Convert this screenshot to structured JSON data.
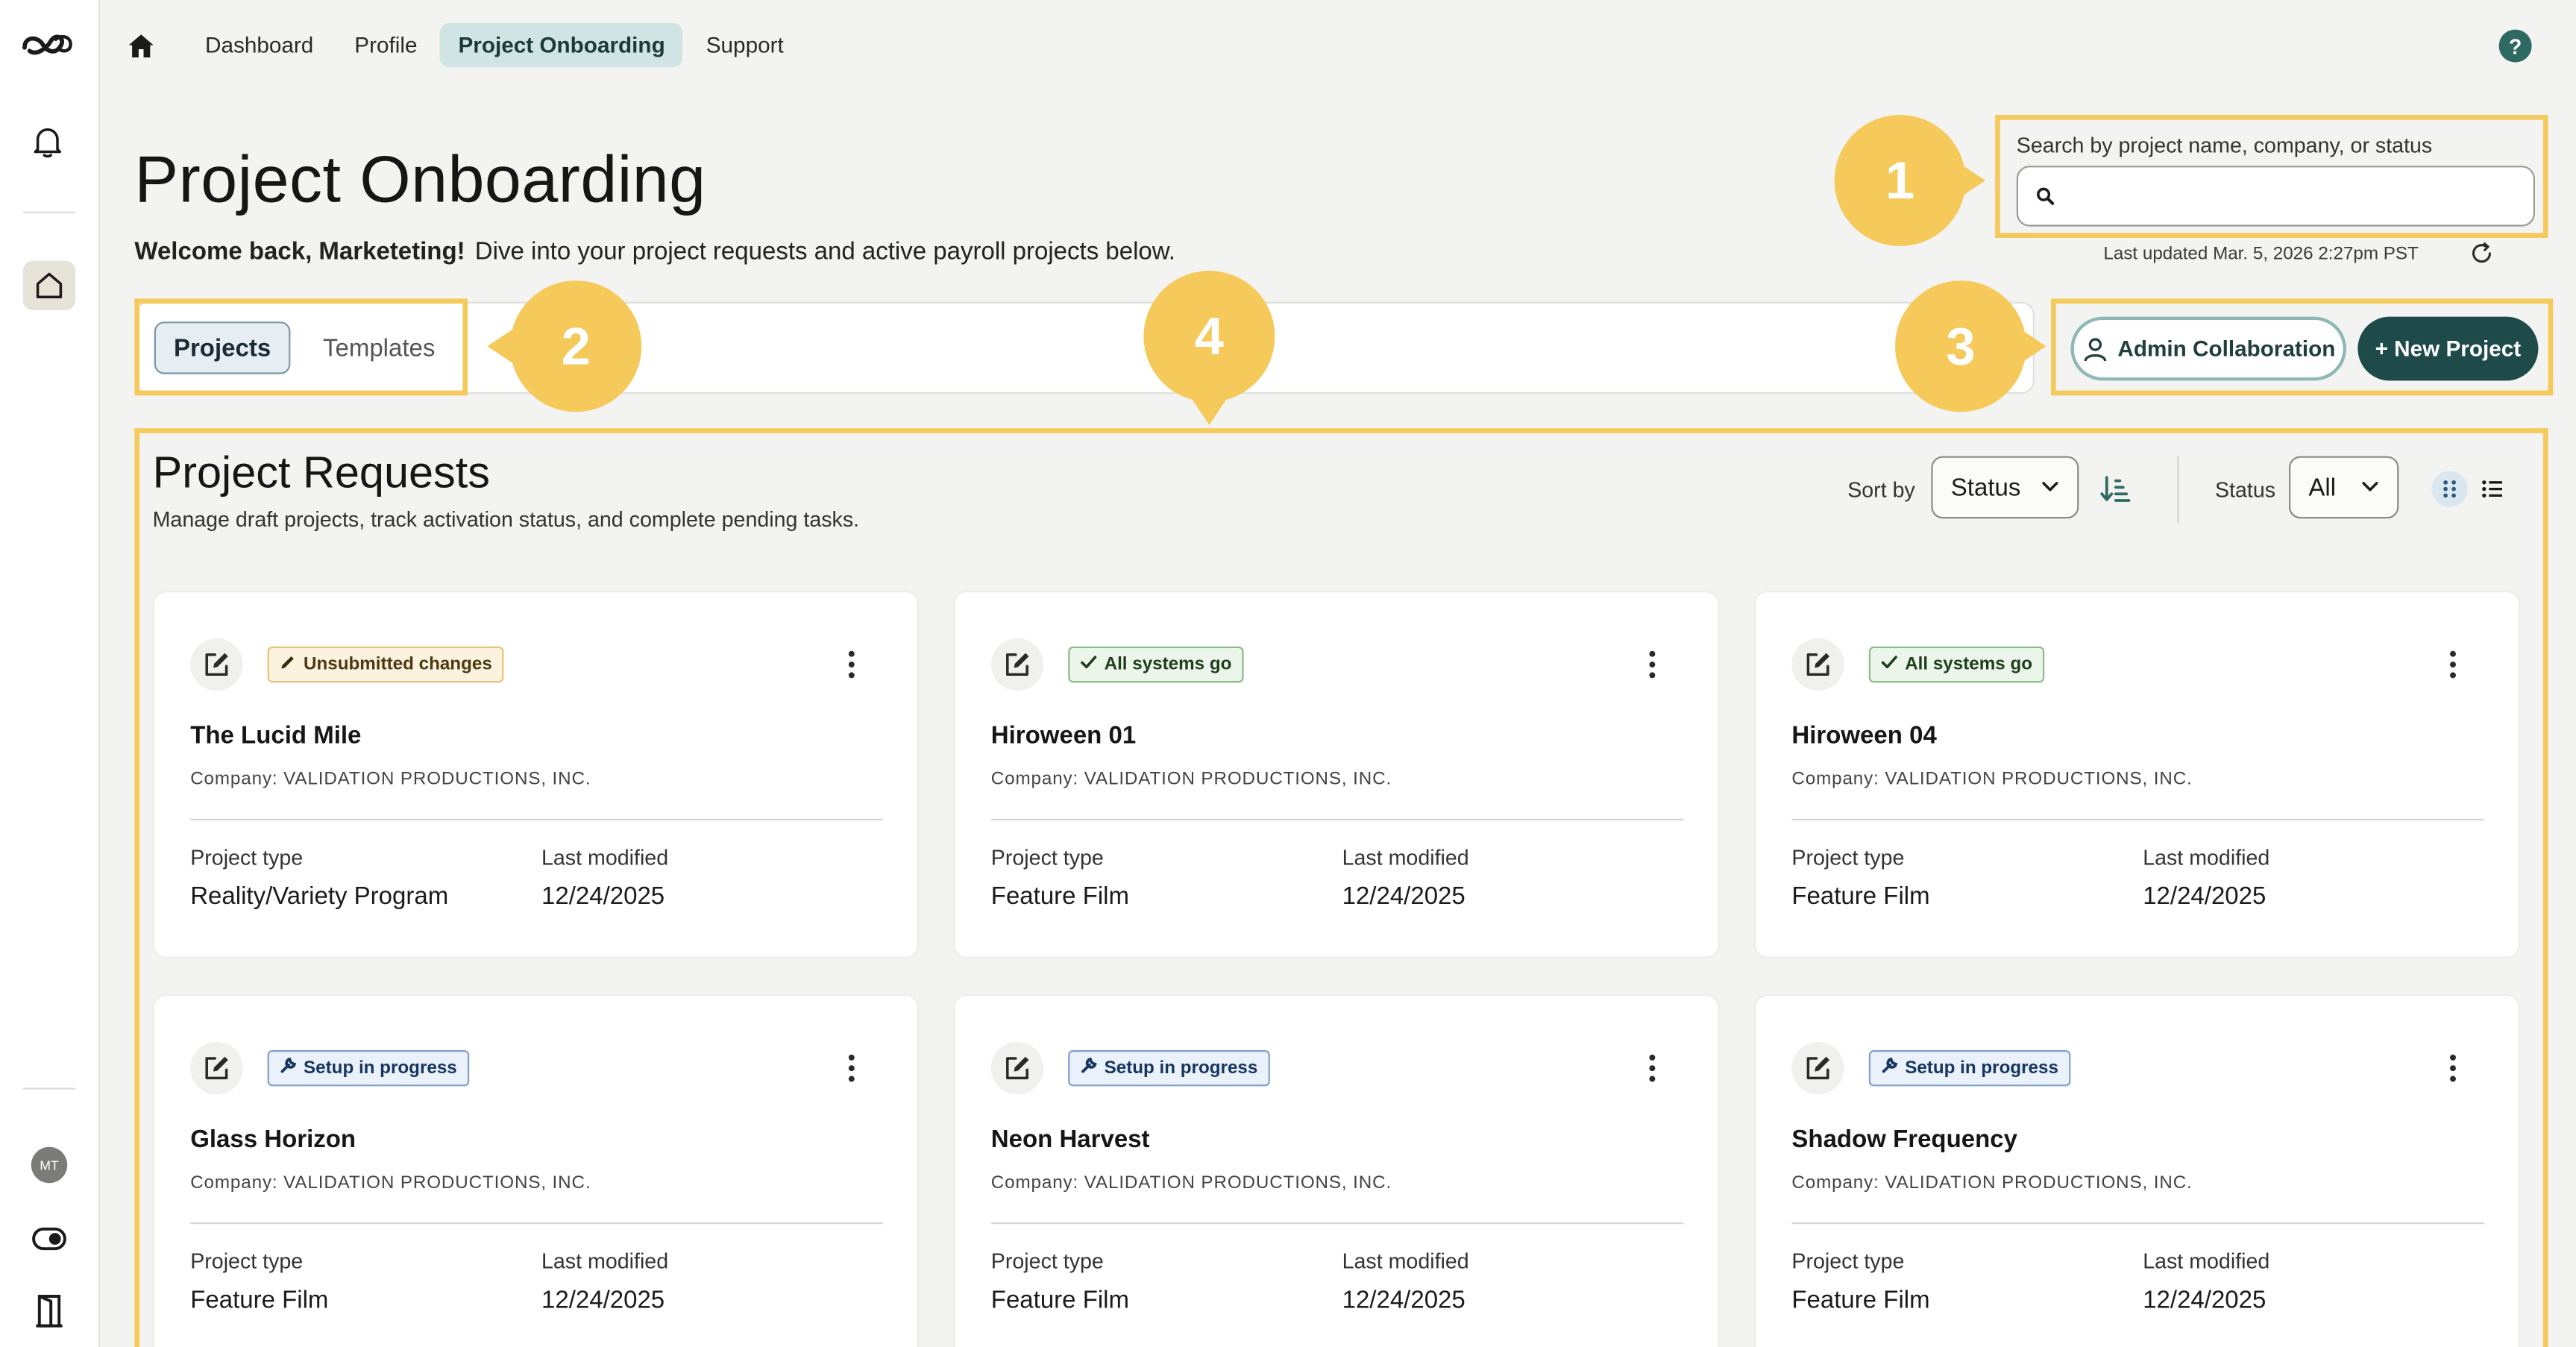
{
  "nav": {
    "links": [
      "Dashboard",
      "Profile",
      "Project Onboarding",
      "Support"
    ],
    "active_index": 2,
    "help": "?"
  },
  "user": {
    "initials": "MT"
  },
  "page": {
    "title": "Project Onboarding",
    "welcome_bold": "Welcome back, Marketeting!",
    "welcome_rest": "Dive into your project requests and active payroll projects below."
  },
  "search": {
    "label": "Search by project name, company, or status",
    "value": "",
    "placeholder": "",
    "last_updated": "Last updated Mar. 5, 2026 2:27pm PST"
  },
  "tabs": {
    "projects": "Projects",
    "templates": "Templates"
  },
  "actions": {
    "admin": "Admin Collaboration",
    "new": "+ New Project"
  },
  "callouts": [
    "1",
    "2",
    "3",
    "4"
  ],
  "requests": {
    "title": "Project Requests",
    "subtitle": "Manage draft projects, track activation status, and complete pending tasks.",
    "sort_label": "Sort by",
    "sort_value": "Status",
    "status_label": "Status",
    "status_value": "All",
    "field_type": "Project type",
    "field_modified": "Last modified",
    "cards": [
      {
        "badge": "Unsubmitted changes",
        "badge_kind": "warn",
        "name": "The Lucid Mile",
        "company": "Company: VALIDATION PRODUCTIONS, INC.",
        "type": "Reality/Variety Program",
        "modified": "12/24/2025"
      },
      {
        "badge": "All systems go",
        "badge_kind": "ok",
        "name": "Hiroween 01",
        "company": "Company: VALIDATION PRODUCTIONS, INC.",
        "type": "Feature Film",
        "modified": "12/24/2025"
      },
      {
        "badge": "All systems go",
        "badge_kind": "ok",
        "name": "Hiroween 04",
        "company": "Company: VALIDATION PRODUCTIONS, INC.",
        "type": "Feature Film",
        "modified": "12/24/2025"
      },
      {
        "badge": "Setup in progress",
        "badge_kind": "setup",
        "name": "Glass Horizon",
        "company": "Company: VALIDATION PRODUCTIONS, INC.",
        "type": "Feature Film",
        "modified": "12/24/2025"
      },
      {
        "badge": "Setup in progress",
        "badge_kind": "setup",
        "name": "Neon Harvest",
        "company": "Company: VALIDATION PRODUCTIONS, INC.",
        "type": "Feature Film",
        "modified": "12/24/2025"
      },
      {
        "badge": "Setup in progress",
        "badge_kind": "setup",
        "name": "Shadow Frequency",
        "company": "Company: VALIDATION PRODUCTIONS, INC.",
        "type": "Feature Film",
        "modified": "12/24/2025"
      }
    ]
  },
  "colors": {
    "accent": "#1f4a4a",
    "callout": "#f5c95a",
    "nav_active_bg": "#cfe4e3"
  },
  "icons": [
    "logo-icon",
    "bell-icon",
    "home-icon",
    "toggle-icon",
    "door-icon",
    "search-icon",
    "refresh-icon",
    "user-icon",
    "sort-direction-icon",
    "grid-view-icon",
    "list-view-icon",
    "edit-icon",
    "kebab-menu-icon",
    "chevron-down-icon",
    "help-icon"
  ]
}
